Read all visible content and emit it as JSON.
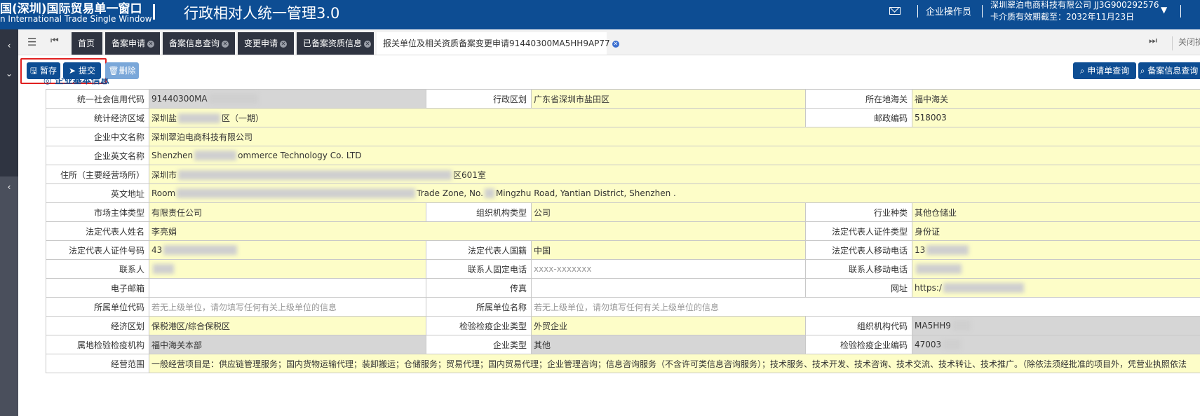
{
  "header": {
    "brand_cn": "国(深圳)国际贸易单一窗口",
    "brand_en": "n International Trade Single Window",
    "system_title": "行政相对人统一管理3.0",
    "role": "企业操作员",
    "company": "深圳翠泊电商科技有限公司 JJ3G900292576",
    "card_validity": "卡介质有效期截至：2032年11月23日",
    "dropdown_glyph": "▼"
  },
  "leftbar": {
    "arrows": [
      "‹",
      "⌄",
      "‹"
    ]
  },
  "tabbar": {
    "menu_glyph": "☰",
    "back_glyph": "⏮",
    "forward_glyph": "⏭",
    "tabs": [
      {
        "label": "首页",
        "closable": false
      },
      {
        "label": "备案申请",
        "closable": true
      },
      {
        "label": "备案信息查询",
        "closable": true
      },
      {
        "label": "变更申请",
        "closable": true
      },
      {
        "label": "已备案资质信息",
        "closable": true
      },
      {
        "label": "报关单位及相关资质备案变更申请91440300MA5HH9AP77",
        "closable": true,
        "active": true
      }
    ],
    "close_ops": "关闭操"
  },
  "toolbar": {
    "save": "暂存",
    "submit": "提交",
    "delete": "删除",
    "query_application": "申请单查询",
    "query_record": "备案信息查询"
  },
  "section": {
    "title": "企业基本信息"
  },
  "form": {
    "credit_code_label": "统一社会信用代码",
    "credit_code_value": "91440300MA",
    "admin_region_label": "行政区划",
    "admin_region_value": "广东省深圳市盐田区",
    "customs_label": "所在地海关",
    "customs_value": "福中海关",
    "econ_area_label": "统计经济区域",
    "econ_area_value_a": "深圳盐",
    "econ_area_value_b": "区（一期）",
    "postcode_label": "邮政编码",
    "postcode_value": "518003",
    "name_cn_label": "企业中文名称",
    "name_cn_value": "深圳翠泊电商科技有限公司",
    "name_en_label": "企业英文名称",
    "name_en_value_a": "Shenzhen",
    "name_en_value_b": "ommerce Technology Co. LTD",
    "address_label": "住所（主要经营场所）",
    "address_value_a": "深圳市",
    "address_value_b": "区601室",
    "en_address_label": "英文地址",
    "en_address_value_a": "Room",
    "en_address_value_b": "Trade Zone, No.",
    "en_address_value_c": "Mingzhu Road, Yantian District, Shenzhen .",
    "entity_type_label": "市场主体类型",
    "entity_type_value": "有限责任公司",
    "org_type_label": "组织机构类型",
    "org_type_value": "公司",
    "industry_label": "行业种类",
    "industry_value": "其他仓储业",
    "legal_name_label": "法定代表人姓名",
    "legal_name_value": "李亮娟",
    "legal_id_type_label": "法定代表人证件类型",
    "legal_id_type_value": "身份证",
    "legal_id_no_label": "法定代表人证件号码",
    "legal_id_no_value": "43",
    "nationality_label": "法定代表人国籍",
    "nationality_value": "中国",
    "legal_mobile_label": "法定代表人移动电话",
    "legal_mobile_value": "13",
    "contact_label": "联系人",
    "contact_phone_label": "联系人固定电话",
    "contact_phone_placeholder": "xxxx-xxxxxxx",
    "contact_mobile_label": "联系人移动电话",
    "email_label": "电子邮箱",
    "fax_label": "传真",
    "website_label": "网址",
    "website_value": "https:/",
    "parent_code_label": "所属单位代码",
    "parent_code_placeholder": "若无上级单位，请勿填写任何有关上级单位的信息",
    "parent_name_label": "所属单位名称",
    "parent_name_placeholder": "若无上级单位，请勿填写任何有关上级单位的信息",
    "econ_zone_label": "经济区划",
    "econ_zone_value": "保税港区/综合保税区",
    "ciq_type_label": "检验检疫企业类型",
    "ciq_type_value": "外贸企业",
    "org_code_label": "组织机构代码",
    "org_code_value": "MA5HH9",
    "ciq_org_label": "属地检验检疫机构",
    "ciq_org_value": "福中海关本部",
    "ent_type_label": "企业类型",
    "ent_type_value": "其他",
    "ciq_code_label": "检验检疫企业编码",
    "ciq_code_value": "47003",
    "scope_label": "经营范围",
    "scope_value": "一般经营项目是：供应链管理服务；国内货物运输代理；装卸搬运；仓储服务；贸易代理；国内贸易代理；企业管理咨询；信息咨询服务（不含许可类信息咨询服务）；技术服务、技术开发、技术咨询、技术交流、技术转让、技术推广。（除依法须经批准的项目外，凭营业执照依法"
  }
}
